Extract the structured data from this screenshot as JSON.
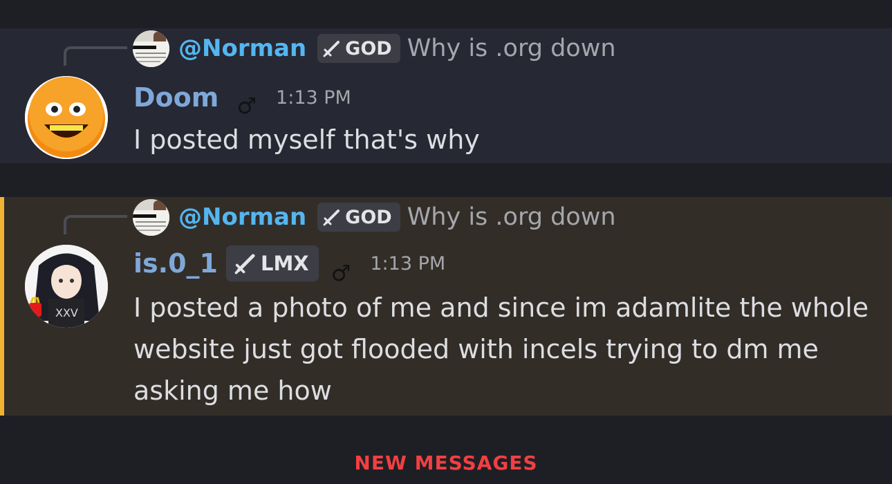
{
  "messages": [
    {
      "reply": {
        "name": "@Norman",
        "role": "GOD",
        "text": "Why is .org down"
      },
      "author": "Doom",
      "gender_symbol": "♂",
      "time": "1:13 PM",
      "content": "I posted myself that's why",
      "colors": {
        "author": "#7fa8d9"
      }
    },
    {
      "reply": {
        "name": "@Norman",
        "role": "GOD",
        "text": "Why is .org down"
      },
      "author": "is.0_1",
      "author_role": "LMX",
      "gender_symbol": "♂",
      "time": "1:13 PM",
      "content": "I posted a photo of me and since im adamlite the whole website just got flooded with incels trying to dm me asking me how",
      "colors": {
        "author": "#7fa8d9",
        "mention_accent": "#f0b232"
      }
    }
  ],
  "divider": {
    "label": "NEW MESSAGES",
    "color": "#f23f42"
  },
  "icons": {
    "sword": "sword-icon",
    "gender": "male-symbol-icon",
    "reply_avatar": "norman-avatar",
    "doom_avatar": "orange-avatar",
    "is01_avatar": "anime-girl-avatar"
  }
}
